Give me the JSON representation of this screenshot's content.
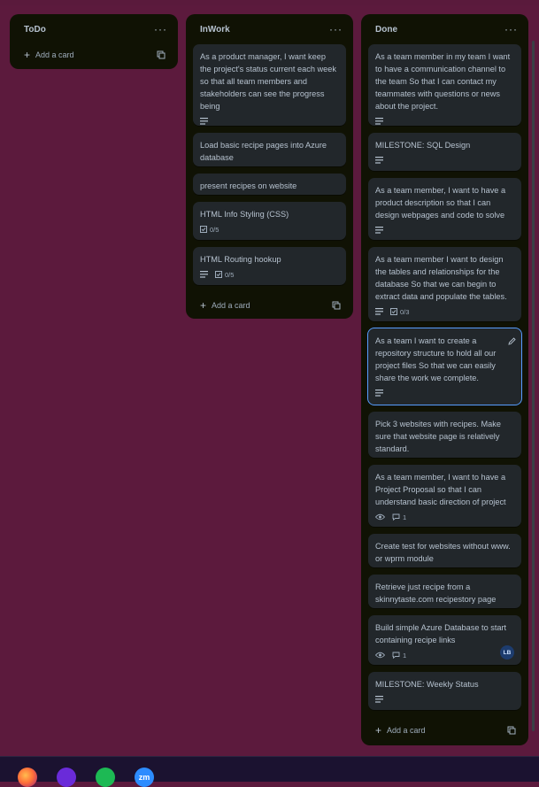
{
  "colors": {
    "board_bg": "#5c1a3d",
    "list_bg": "#101204",
    "card_bg": "#22272b",
    "text": "#b6c2cf",
    "muted": "#9fadbc",
    "selection": "#579dff",
    "avatar_bg": "#1d3c6e"
  },
  "lists": {
    "todo": {
      "title": "ToDo",
      "menu": "···",
      "add_label": "Add a card"
    },
    "inwork": {
      "title": "InWork",
      "menu": "···",
      "add_label": "Add a card",
      "cards": [
        {
          "title": "As a product manager, I want keep the project's status current each week so that all team members and stakeholders can see the progress being"
        },
        {
          "title": "Load basic recipe pages into Azure database"
        },
        {
          "title": "present recipes on website"
        },
        {
          "title": "HTML Info Styling (CSS)",
          "checklist": "0/5"
        },
        {
          "title": "HTML Routing hookup",
          "checklist": "0/5"
        }
      ]
    },
    "done": {
      "title": "Done",
      "menu": "···",
      "add_label": "Add a card",
      "cards": [
        {
          "title": "As a team member in my team I want to have a communication channel to the team So that I can contact my teammates with questions or news about the project."
        },
        {
          "title": "MILESTONE: SQL Design"
        },
        {
          "title": "As a team member, I want to have a product description so that I can design webpages and code to solve"
        },
        {
          "title": "As a team member I want to design the tables and relationships for the database So that we can begin to extract data and populate the tables.",
          "checklist": "0/3"
        },
        {
          "title": "As a team I want to create a repository structure to hold all our project files So that we can easily share the work we complete."
        },
        {
          "title": "Pick 3 websites with recipes. Make sure that website page is relatively standard."
        },
        {
          "title": "As a team member, I want to have a Project Proposal so that I can understand basic direction of project",
          "comments": "1"
        },
        {
          "title": "Create test for websites without www. or wprm module"
        },
        {
          "title": "Retrieve just recipe from a skinnytaste.com recipestory page"
        },
        {
          "title": "Build simple Azure Database to start containing recipe links",
          "comments": "1",
          "avatar": "LB"
        },
        {
          "title": "MILESTONE: Weekly Status"
        }
      ]
    }
  },
  "taskbar": {
    "apps": [
      "firefox-icon",
      "teams-icon",
      "spotify-icon",
      "zoom-icon"
    ],
    "zoom_label": "zm"
  }
}
